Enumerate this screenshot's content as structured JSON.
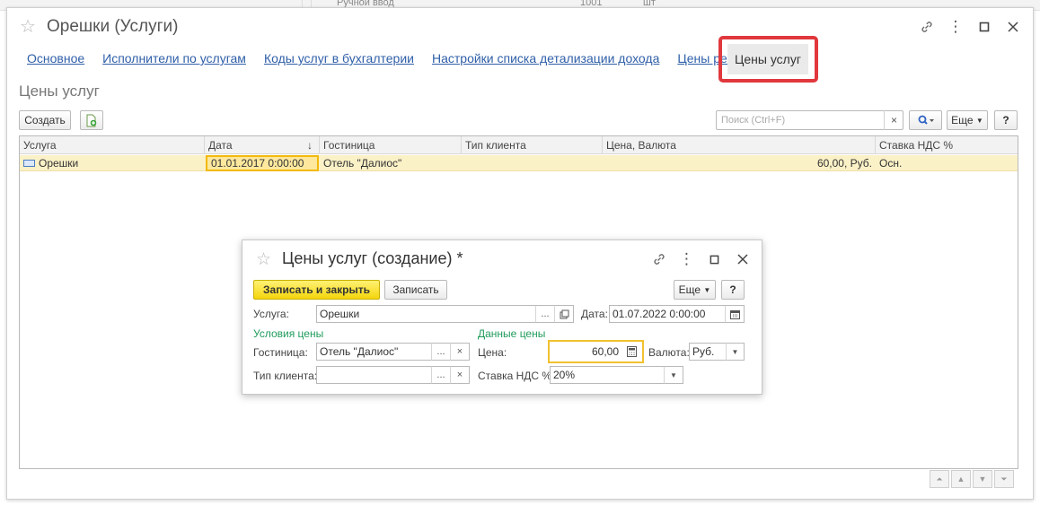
{
  "background": {
    "row_text": "Ручной ввод",
    "row_code": "1001",
    "row_unit": "шт"
  },
  "window": {
    "title": "Орешки (Услуги)"
  },
  "tabs": [
    {
      "label": "Основное"
    },
    {
      "label": "Исполнители по услугам"
    },
    {
      "label": "Коды услуг в бухгалтерии"
    },
    {
      "label": "Настройки списка детализации дохода"
    },
    {
      "label": "Цены ресурсов"
    },
    {
      "label": "Цены услуг"
    }
  ],
  "section": {
    "title": "Цены услуг"
  },
  "toolbar": {
    "create_label": "Создать",
    "search_placeholder": "Поиск (Ctrl+F)",
    "more_label": "Еще",
    "help_label": "?"
  },
  "grid": {
    "columns": [
      "Услуга",
      "Дата",
      "Гостиница",
      "Тип клиента",
      "Цена, Валюта",
      "Ставка НДС %"
    ],
    "rows": [
      {
        "service": "Орешки",
        "date": "01.01.2017 0:00:00",
        "hotel": "Отель \"Далиос\"",
        "client_type": "",
        "price": "60,00, Руб.",
        "vat": "Осн."
      }
    ]
  },
  "dialog": {
    "title": "Цены услуг (создание) *",
    "save_close_label": "Записать и закрыть",
    "save_label": "Записать",
    "more_label": "Еще",
    "help_label": "?",
    "service_label": "Услуга:",
    "service_value": "Орешки",
    "date_label": "Дата:",
    "date_value": "01.07.2022  0:00:00",
    "conditions_group": "Условия цены",
    "price_group": "Данные цены",
    "hotel_label": "Гостиница:",
    "hotel_value": "Отель \"Далиос\"",
    "price_label": "Цена:",
    "price_value": "60,00",
    "currency_label": "Валюта:",
    "currency_value": "Руб.",
    "client_type_label": "Тип клиента:",
    "client_type_value": "",
    "vat_label": "Ставка НДС %:",
    "vat_value": "20%"
  },
  "colors": {
    "link": "#2f5fa8",
    "highlight": "#e0383d",
    "selected_row": "#fbf1c7",
    "primary_button": "#f4d60c",
    "group_label": "#1f9b5b"
  }
}
